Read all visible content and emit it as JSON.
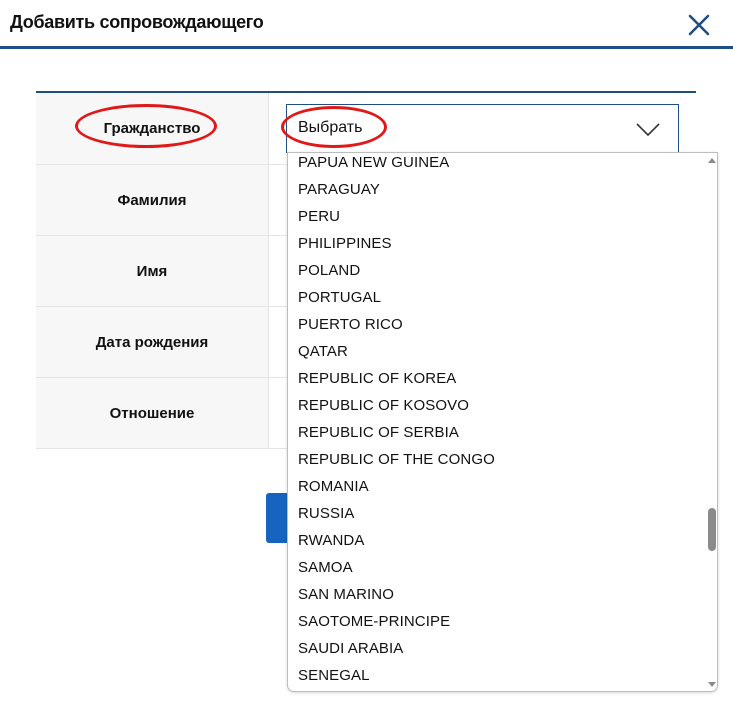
{
  "dialog": {
    "title": "Добавить сопровождающего",
    "close_icon": "close-icon"
  },
  "form": {
    "rows": [
      {
        "label": "Гражданство"
      },
      {
        "label": "Фамилия"
      },
      {
        "label": "Имя"
      },
      {
        "label": "Дата рождения"
      },
      {
        "label": "Отношение"
      }
    ],
    "citizenship_select": {
      "value": "Выбрать",
      "chevron_icon": "chevron-down-icon"
    }
  },
  "dropdown": {
    "options": [
      "PAPUA NEW GUINEA",
      "PARAGUAY",
      "PERU",
      "PHILIPPINES",
      "POLAND",
      "PORTUGAL",
      "PUERTO RICO",
      "QATAR",
      "REPUBLIC OF KOREA",
      "REPUBLIC OF KOSOVO",
      "REPUBLIC OF SERBIA",
      "REPUBLIC OF THE CONGO",
      "ROMANIA",
      "RUSSIA",
      "RWANDA",
      "SAMOA",
      "SAN MARINO",
      "SAOTOME-PRINCIPE",
      "SAUDI ARABIA",
      "SENEGAL"
    ]
  },
  "colors": {
    "accent": "#1f4f82",
    "button_blue": "#1565c0",
    "annotation_red": "#e01818"
  }
}
